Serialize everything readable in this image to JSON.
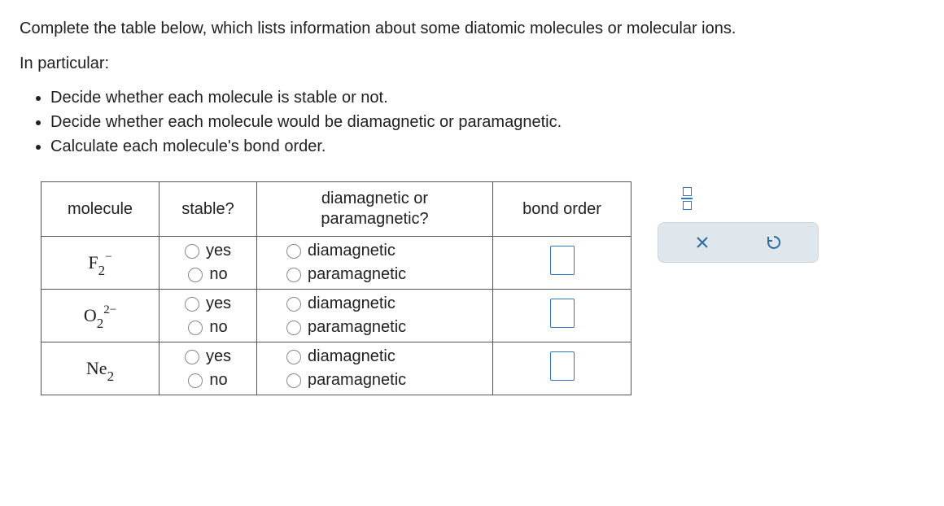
{
  "instructions": {
    "intro": "Complete the table below, which lists information about some diatomic molecules or molecular ions.",
    "lead": "In particular:",
    "bullets": [
      "Decide whether each molecule is stable or not.",
      "Decide whether each molecule would be diamagnetic or paramagnetic.",
      "Calculate each molecule's bond order."
    ]
  },
  "table": {
    "headers": {
      "molecule": "molecule",
      "stable": "stable?",
      "magnetic": "diamagnetic or paramagnetic?",
      "bond": "bond order"
    },
    "stable_options": {
      "yes": "yes",
      "no": "no"
    },
    "mag_options": {
      "dia": "diamagnetic",
      "para": "paramagnetic"
    },
    "rows": [
      {
        "base": "F",
        "sub": "2",
        "sup": "−"
      },
      {
        "base": "O",
        "sub": "2",
        "sup": "2−"
      },
      {
        "base": "Ne",
        "sub": "2",
        "sup": ""
      }
    ]
  }
}
